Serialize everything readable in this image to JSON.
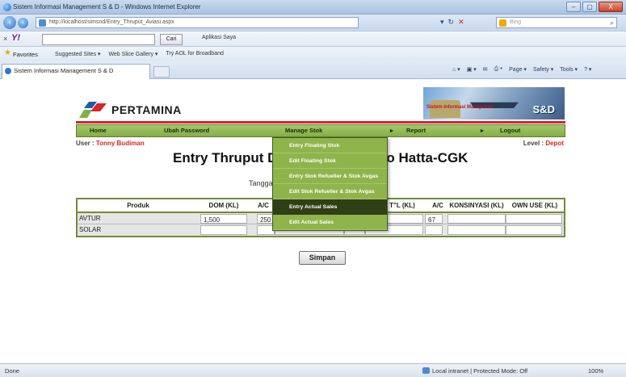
{
  "window": {
    "title": "Sistem Informasi Management S & D - Windows Internet Explorer",
    "controls": [
      "–",
      "▢",
      "X"
    ]
  },
  "address": {
    "url": "http://localhost/simsnd/Entry_Thruput_Aviasi.aspx",
    "search_placeholder": "Bing"
  },
  "yahoo_toolbar": {
    "logo": "Y!",
    "search_button": "Cari",
    "items": [
      "Aplikasi Saya"
    ]
  },
  "favorites": {
    "label": "Favorites",
    "links": [
      "Suggested Sites ▾",
      "Web Slice Gallery ▾",
      "Try AOL for Broadband"
    ]
  },
  "tab": {
    "title": "Sistem Informasi Management S & D"
  },
  "command_bar": {
    "items": [
      "Page ▾",
      "Safety ▾",
      "Tools ▾"
    ]
  },
  "site": {
    "logo_text": "PERTAMINA",
    "banner_title": "Sistem Informasi Manajemen",
    "banner_sd": "S&D",
    "accent_red": "#d9232d",
    "accent_green": "#85ad47"
  },
  "nav": {
    "items": [
      {
        "label": "Home"
      },
      {
        "label": "Ubah Password"
      },
      {
        "label": "Manage Stok"
      },
      {
        "label": "Report"
      },
      {
        "label": "Logout"
      }
    ]
  },
  "dropdown": {
    "items": [
      "Entry Floating Stok",
      "Edit Floating Stok",
      "Entry Stok Refueller & Stok Avgas",
      "Edit Stok Refueller & Stok Avgas",
      "Entry Actual Sales",
      "Edit Actual Sales"
    ],
    "active_index": 4
  },
  "user": {
    "label": "User : ",
    "name": "Tonny Budiman",
    "level_label": "Level : ",
    "level": "Depot"
  },
  "page": {
    "title_left": "Entry Thruput D",
    "title_right": "o Hatta-CGK",
    "date_label": "Tanggal"
  },
  "table": {
    "headers": [
      "Produk",
      "DOM (KL)",
      "A/C",
      "",
      "",
      "",
      "T\"L (KL)",
      "A/C",
      "KONSINYASI (KL)",
      "OWN USE (KL)"
    ],
    "rows": [
      {
        "produk": "AVTUR",
        "dom": "1,500",
        "ac1": "250",
        "intl": "1,200",
        "ac2": "67"
      },
      {
        "produk": "SOLAR",
        "dom": "",
        "ac1": "",
        "intl": "",
        "ac2": ""
      }
    ]
  },
  "buttons": {
    "save": "Simpan"
  },
  "status": {
    "left": "Done",
    "zone": "Local intranet | Protected Mode: Off",
    "zoom": "100%"
  }
}
